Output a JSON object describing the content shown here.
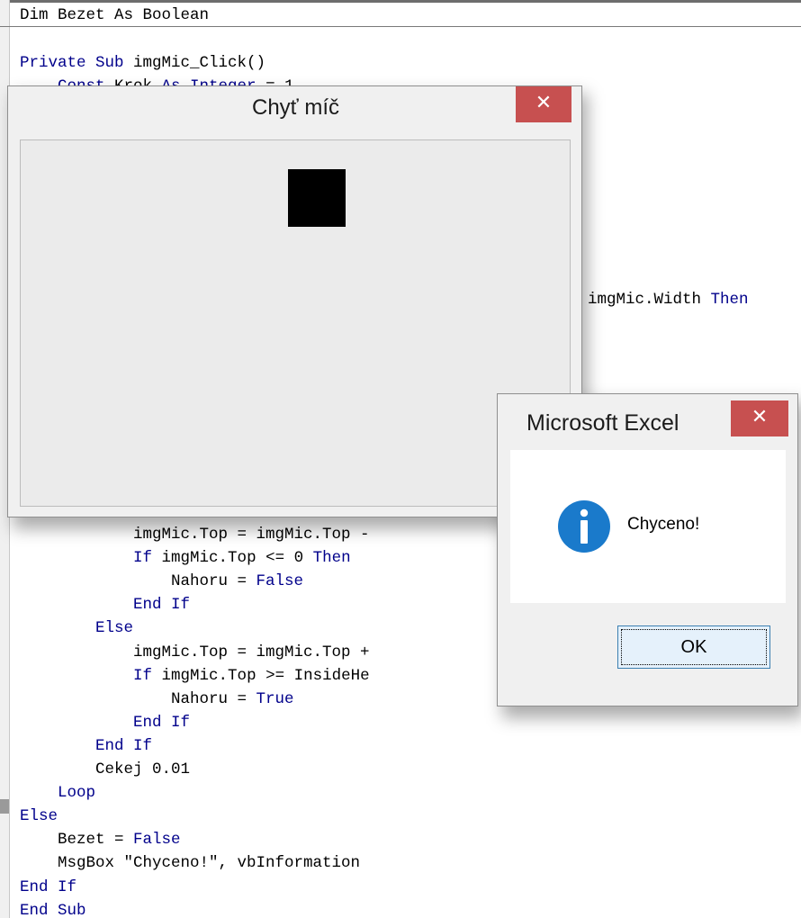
{
  "code_editor": {
    "declaration": "Dim Bezet As Boolean",
    "lines_top": [
      [
        {
          "t": "Private Sub ",
          "kw": true
        },
        {
          "t": "imgMic_Click()"
        }
      ],
      [
        {
          "t": "    "
        },
        {
          "t": "Const",
          "kw": true
        },
        {
          "t": " Krok "
        },
        {
          "t": "As Integer",
          "kw": true
        },
        {
          "t": " = 1"
        }
      ]
    ],
    "right_fragment": [
      {
        "t": "imgMic.Width "
      },
      {
        "t": "Then",
        "kw": true
      }
    ],
    "lines_bottom": [
      [
        {
          "t": "            imgMic.Top = imgMic.Top -"
        }
      ],
      [
        {
          "t": "            "
        },
        {
          "t": "If",
          "kw": true
        },
        {
          "t": " imgMic.Top <= 0 "
        },
        {
          "t": "Then",
          "kw": true
        }
      ],
      [
        {
          "t": "                Nahoru = "
        },
        {
          "t": "False",
          "kw": true
        }
      ],
      [
        {
          "t": "            "
        },
        {
          "t": "End If",
          "kw": true
        }
      ],
      [
        {
          "t": "        "
        },
        {
          "t": "Else",
          "kw": true
        }
      ],
      [
        {
          "t": "            imgMic.Top = imgMic.Top +"
        }
      ],
      [
        {
          "t": "            "
        },
        {
          "t": "If",
          "kw": true
        },
        {
          "t": " imgMic.Top >= InsideHe"
        }
      ],
      [
        {
          "t": "                Nahoru = "
        },
        {
          "t": "True",
          "kw": true
        }
      ],
      [
        {
          "t": "            "
        },
        {
          "t": "End If",
          "kw": true
        }
      ],
      [
        {
          "t": "        "
        },
        {
          "t": "End If",
          "kw": true
        }
      ],
      [
        {
          "t": "        Cekej 0.01"
        }
      ],
      [
        {
          "t": "    "
        },
        {
          "t": "Loop",
          "kw": true
        }
      ],
      [
        {
          "t": "Else",
          "kw": true
        }
      ],
      [
        {
          "t": "    Bezet = "
        },
        {
          "t": "False",
          "kw": true
        }
      ],
      [
        {
          "t": "    MsgBox \"Chyceno!\", vbInformation"
        }
      ],
      [
        {
          "t": "End If",
          "kw": true
        }
      ],
      [
        {
          "t": "End Sub",
          "kw": true
        }
      ]
    ]
  },
  "game_window": {
    "title": "Chyť míč",
    "close_glyph": "✕"
  },
  "message_box": {
    "title": "Microsoft Excel",
    "close_glyph": "✕",
    "icon": "information-icon",
    "message": "Chyceno!",
    "ok_label": "OK"
  },
  "colors": {
    "keyword": "#00008b",
    "close_button": "#c75050",
    "info_icon": "#1a7acb"
  }
}
